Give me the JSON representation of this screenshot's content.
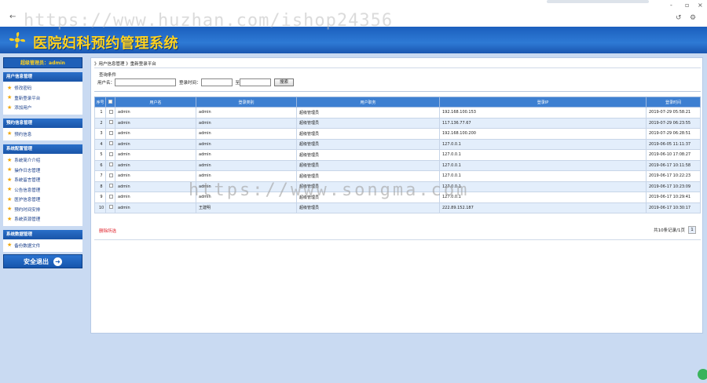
{
  "browser": {
    "back": "←",
    "window_min": "-",
    "window_restore": "▫",
    "window_close": "×",
    "tool_refresh": "↺",
    "tool_settings": "⚙"
  },
  "header": {
    "title": "医院妇科预约管理系统",
    "logo_icon": "pinwheel-icon"
  },
  "watermarks": {
    "top": "https://www.huzhan.com/ishop24356",
    "center": "https://www.songma.com"
  },
  "sidebar": {
    "welcome": "超级管理员：admin",
    "sections": [
      {
        "title": "用户信息管理",
        "items": [
          "修改密码",
          "重新登录平台",
          "添加用户"
        ]
      },
      {
        "title": "预约信息管理",
        "items": [
          "预约信息"
        ]
      },
      {
        "title": "系统配置管理",
        "items": [
          "系统简介介绍",
          "操作日志管理",
          "系统留言管理",
          "公告信息管理",
          "医护信息管理",
          "预约时间安排",
          "系统资源管理"
        ]
      },
      {
        "title": "系统数据管理",
        "items": [
          "备份数据文件"
        ]
      }
    ],
    "logout": "安全退出",
    "logout_icon": "arrow-right-icon"
  },
  "main": {
    "breadcrumb": "》用户信息管理 》重新登录平台",
    "query": {
      "label": "查询条件",
      "fields": [
        {
          "label": "用户名：",
          "value": ""
        },
        {
          "label": "登录时间：",
          "value": ""
        },
        {
          "label": "至",
          "value": ""
        }
      ],
      "button": "搜索"
    },
    "table": {
      "headers": [
        "序号",
        "",
        "用户名",
        "登录类别",
        "用户职务",
        "登录IP",
        "登录时间"
      ],
      "rows": [
        [
          "1",
          "admin",
          "admin",
          "超级管理员",
          "192.168.100.153",
          "2019-07-29 05:58:21"
        ],
        [
          "2",
          "admin",
          "admin",
          "超级管理员",
          "117.136.77.67",
          "2019-07-29 06:23:55"
        ],
        [
          "3",
          "admin",
          "admin",
          "超级管理员",
          "192.168.100.200",
          "2019-07-29 06:28:51"
        ],
        [
          "4",
          "admin",
          "admin",
          "超级管理员",
          "127.0.0.1",
          "2019-06-05 11:11:37"
        ],
        [
          "5",
          "admin",
          "admin",
          "超级管理员",
          "127.0.0.1",
          "2019-06-10 17:08:27"
        ],
        [
          "6",
          "admin",
          "admin",
          "超级管理员",
          "127.0.0.1",
          "2019-06-17 10:11:58"
        ],
        [
          "7",
          "admin",
          "admin",
          "超级管理员",
          "127.0.0.1",
          "2019-06-17 10:22:23"
        ],
        [
          "8",
          "admin",
          "admin",
          "超级管理员",
          "127.0.0.1",
          "2019-06-17 10:23:09"
        ],
        [
          "9",
          "admin",
          "admin",
          "超级管理员",
          "127.0.0.1",
          "2019-06-17 10:29:41"
        ],
        [
          "10",
          "admin",
          "王建明",
          "超级管理员",
          "222.89.152.187",
          "2019-06-17 10:30:17"
        ]
      ]
    },
    "delete_label": "删除所选",
    "pager": {
      "summary": "共10条记录/1页",
      "current": "1"
    }
  },
  "colors": {
    "banner": "#1b5fbd",
    "title": "#ffd21f",
    "table_header": "#3d7fd1",
    "row_alt": "#e3eefb",
    "delete": "#e0202a"
  }
}
